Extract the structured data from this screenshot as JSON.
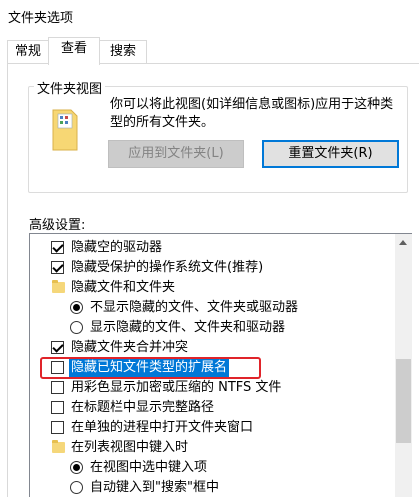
{
  "window": {
    "title": "文件夹选项"
  },
  "tabs": [
    {
      "label": "常规",
      "active": false
    },
    {
      "label": "查看",
      "active": true
    },
    {
      "label": "搜索",
      "active": false
    }
  ],
  "folder_views": {
    "legend": "文件夹视图",
    "description": "你可以将此视图(如详细信息或图标)应用于这种类型的所有文件夹。",
    "apply_button": "应用到文件夹(L)",
    "reset_button": "重置文件夹(R)"
  },
  "advanced": {
    "label": "高级设置:",
    "items": [
      {
        "type": "checkbox",
        "checked": true,
        "indent": 1,
        "label": "隐藏空的驱动器"
      },
      {
        "type": "checkbox",
        "checked": true,
        "indent": 1,
        "label": "隐藏受保护的操作系统文件(推荐)"
      },
      {
        "type": "folder",
        "checked": false,
        "indent": 1,
        "label": "隐藏文件和文件夹"
      },
      {
        "type": "radio",
        "checked": true,
        "indent": 2,
        "label": "不显示隐藏的文件、文件夹或驱动器"
      },
      {
        "type": "radio",
        "checked": false,
        "indent": 2,
        "label": "显示隐藏的文件、文件夹和驱动器"
      },
      {
        "type": "checkbox",
        "checked": true,
        "indent": 1,
        "label": "隐藏文件夹合并冲突"
      },
      {
        "type": "checkbox",
        "checked": false,
        "indent": 1,
        "label": "隐藏已知文件类型的扩展名",
        "selected": true
      },
      {
        "type": "checkbox",
        "checked": false,
        "indent": 1,
        "label": "用彩色显示加密或压缩的 NTFS 文件"
      },
      {
        "type": "checkbox",
        "checked": false,
        "indent": 1,
        "label": "在标题栏中显示完整路径"
      },
      {
        "type": "checkbox",
        "checked": false,
        "indent": 1,
        "label": "在单独的进程中打开文件夹窗口"
      },
      {
        "type": "folder",
        "checked": false,
        "indent": 1,
        "label": "在列表视图中键入时"
      },
      {
        "type": "radio",
        "checked": true,
        "indent": 2,
        "label": "在视图中选中键入项"
      },
      {
        "type": "radio",
        "checked": false,
        "indent": 2,
        "label": "自动键入到\"搜索\"框中"
      }
    ]
  },
  "colors": {
    "accent": "#0078d7",
    "highlight_box": "#e0242a"
  }
}
